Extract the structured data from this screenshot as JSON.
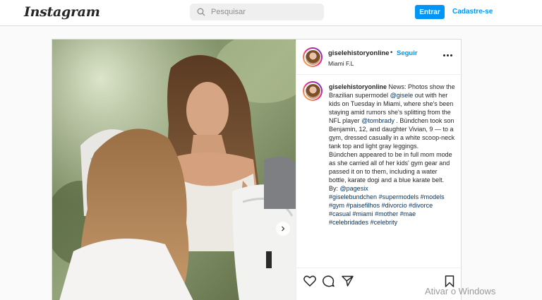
{
  "nav": {
    "logo": "Instagram",
    "search_placeholder": "Pesquisar",
    "login_label": "Entrar",
    "signup_label": "Cadastre-se"
  },
  "post": {
    "username": "giselehistoryonline",
    "follow_separator": "•",
    "follow_label": "Seguir",
    "location": "Miami F.L",
    "caption": {
      "username": "giselehistoryonline",
      "p1_a": "News: Photos show the Brazilian supermodel",
      "mention1": "@gisele",
      "p1_b": "out with her kids on Tuesday in Miami, where she's been staying amid rumors she's splitting from the NFL player",
      "mention2": "@tombrady",
      "p1_c": ". Bündchen took son Benjamin, 12, and daughter Vivian, 9 — to a gym, dressed casually in a white scoop-neck tank top and light gray leggings.",
      "p2": "Bündchen appeared to be in full mom mode as she carried all of her kids' gym gear and passed it on to them, including a water bottle, karate dogi and a blue karate belt.",
      "by_prefix": "By:",
      "by_mention": "@pagesix",
      "hashtags": [
        "#giselebundchen",
        "#supermodels",
        "#models",
        "#gym",
        "#paisefilhos",
        "#divorcio",
        "#divorce",
        "#casual",
        "#miami",
        "#mother",
        "#mae",
        "#celebridades",
        "#celebrity"
      ]
    }
  },
  "os_watermark": "Ativar o Windows",
  "colors": {
    "accent": "#0095f6",
    "link": "#00376b",
    "text": "#262626"
  },
  "icons": [
    "search-icon",
    "more-options-icon",
    "heart-icon",
    "comment-icon",
    "share-icon",
    "bookmark-icon",
    "next-arrow-icon"
  ]
}
